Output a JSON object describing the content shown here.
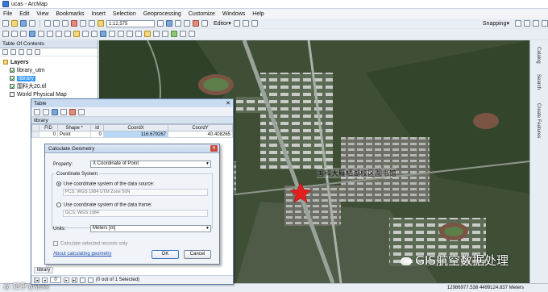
{
  "window": {
    "title": "ucas - ArcMap"
  },
  "menu": [
    "File",
    "Edit",
    "View",
    "Bookmarks",
    "Insert",
    "Selection",
    "Geoprocessing",
    "Customize",
    "Windows",
    "Help"
  ],
  "toolbar": {
    "scale": "1:12,575",
    "editor_label": "Editor▾",
    "snapping_label": "Snapping▾"
  },
  "toc": {
    "title": "Table Of Contents",
    "group": "Layers",
    "layers": [
      {
        "name": "library_utm",
        "checked": true,
        "selected": false
      },
      {
        "name": "library",
        "checked": true,
        "selected": true
      },
      {
        "name": "国科大20.tif",
        "checked": true,
        "selected": false
      },
      {
        "name": "World Physical Map",
        "checked": false,
        "selected": false
      }
    ]
  },
  "right_panel": {
    "labels": [
      "Catalog",
      "Search",
      "Create Features"
    ]
  },
  "map": {
    "annotation": "国科大雁栖湖校区图书馆",
    "watermark": "GIS航空数据处理",
    "corner_watermark": "@ 知乎@张翔"
  },
  "table_window": {
    "title": "Table",
    "tab": "library",
    "columns": [
      "FID",
      "Shape *",
      "Id",
      "CoordX",
      "CoordY"
    ],
    "rows": [
      {
        "fid": "0",
        "shape": "Point",
        "id": "0",
        "coordx": "116.679267",
        "coordy": "40.408265"
      }
    ],
    "footer": {
      "position": "0",
      "selected_text": "(0 out of 1 Selected)"
    },
    "bottom_tab": "library"
  },
  "dialog": {
    "title": "Calculate Geometry",
    "property_label": "Property:",
    "property_value": "X Coordinate of Point",
    "coordinate_system_label": "Coordinate System",
    "option_source": "Use coordinate system of the data source:",
    "source_cs": "PCS: WGS 1984 UTM Zone 50N",
    "option_frame": "Use coordinate system of the data frame:",
    "frame_cs": "GCS: WGS 1984",
    "units_label": "Units:",
    "units_value": "Meters [m]",
    "calc_selected": "Calculate selected records only",
    "help_link": "About calculating geometry",
    "ok": "OK",
    "cancel": "Cancel"
  },
  "status": {
    "coordinates": "12986977.538  4499124.837 Meters"
  }
}
